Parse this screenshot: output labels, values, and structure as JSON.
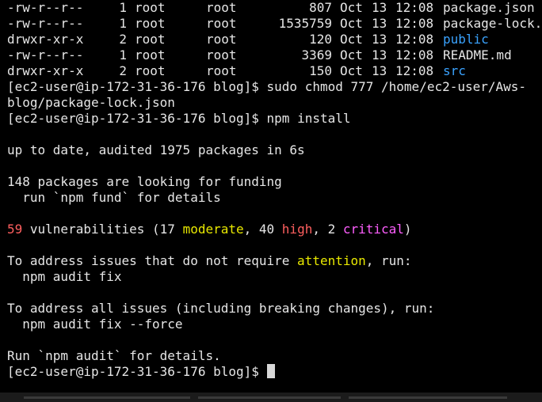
{
  "colors": {
    "background": "#000000",
    "text": "#e6e6e6",
    "directory": "#3aa3ff",
    "error_count": "#ff5f5f",
    "moderate": "#e8e800",
    "high": "#ff5f5f",
    "critical": "#ff5fff",
    "attention": "#e8e800"
  },
  "listing": [
    {
      "perms": "-rw-r--r--",
      "links": "1",
      "owner": "root",
      "group": "root",
      "size": "807",
      "month": "Oct",
      "day": "13",
      "time": "12:08",
      "name": "package.json",
      "is_dir": false
    },
    {
      "perms": "-rw-r--r--",
      "links": "1",
      "owner": "root",
      "group": "root",
      "size": "1535759",
      "month": "Oct",
      "day": "13",
      "time": "12:08",
      "name": "package-lock.",
      "is_dir": false
    },
    {
      "perms": "drwxr-xr-x",
      "links": "2",
      "owner": "root",
      "group": "root",
      "size": "120",
      "month": "Oct",
      "day": "13",
      "time": "12:08",
      "name": "public",
      "is_dir": true
    },
    {
      "perms": "-rw-r--r--",
      "links": "1",
      "owner": "root",
      "group": "root",
      "size": "3369",
      "month": "Oct",
      "day": "13",
      "time": "12:08",
      "name": "README.md",
      "is_dir": false
    },
    {
      "perms": "drwxr-xr-x",
      "links": "2",
      "owner": "root",
      "group": "root",
      "size": "150",
      "month": "Oct",
      "day": "13",
      "time": "12:08",
      "name": "src",
      "is_dir": true
    }
  ],
  "prompt": "[ec2-user@ip-172-31-36-176 blog]$",
  "cmd_chmod_line1": "sudo chmod 777 /home/ec2-user/Aws-",
  "cmd_chmod_line2": "blog/package-lock.json",
  "cmd_npm": "npm install",
  "out_audited": "up to date, audited 1975 packages in 6s",
  "out_funding": "148 packages are looking for funding",
  "out_fund_cmd": "  run `npm fund` for details",
  "vuln": {
    "count": "59",
    "text_a": " vulnerabilities (17 ",
    "moderate": "moderate",
    "text_b": ", 40 ",
    "high": "high",
    "text_c": ", 2 ",
    "critical": "critical",
    "text_d": ")"
  },
  "fix1_a": "To address issues that do not require ",
  "fix1_attention": "attention",
  "fix1_b": ", run:",
  "fix1_cmd": "  npm audit fix",
  "fix2": "To address all issues (including breaking changes), run:",
  "fix2_cmd": "  npm audit fix --force",
  "out_run_audit": "Run `npm audit` for details."
}
